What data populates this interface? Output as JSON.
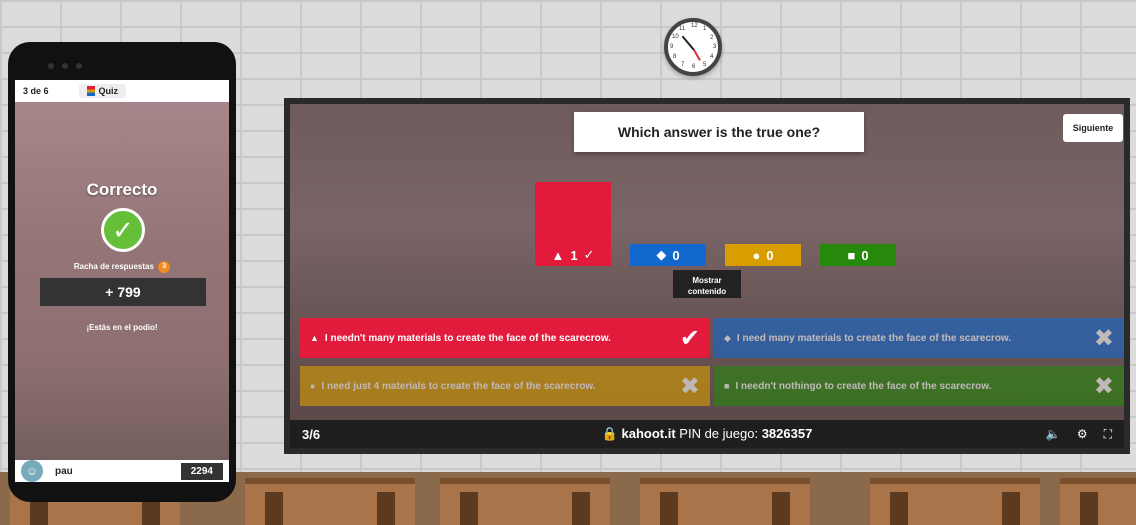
{
  "clock": {
    "numbers": [
      "12",
      "1",
      "2",
      "3",
      "4",
      "5",
      "6",
      "7",
      "8",
      "9",
      "10",
      "11"
    ]
  },
  "phone": {
    "progress": "3 de 6",
    "mode": "Quiz",
    "result": "Correcto",
    "streak_label": "Racha de respuestas",
    "streak_count": "3",
    "points": "+ 799",
    "podium": "¡Estás en el podio!",
    "player": "pau",
    "score": "2294"
  },
  "screen": {
    "question": "Which answer is the true one?",
    "next_label": "Siguiente",
    "show_content": "Mostrar contenido",
    "progress": "3/6",
    "pin_site": "kahoot.it",
    "pin_label": "PIN de juego:",
    "pin": "3826357",
    "bars": [
      {
        "shape": "▲",
        "count": "1",
        "check": "✓",
        "color": "#e21b3c",
        "fraction": 1
      },
      {
        "shape": "◆",
        "count": "0",
        "check": "",
        "color": "#1368ce",
        "fraction": 0
      },
      {
        "shape": "●",
        "count": "0",
        "check": "",
        "color": "#d89e00",
        "fraction": 0
      },
      {
        "shape": "■",
        "count": "0",
        "check": "",
        "color": "#26890c",
        "fraction": 0
      }
    ],
    "answers": [
      {
        "shape": "▲",
        "text": "I needn't many materials to create the face of the scarecrow.",
        "mark": "✔",
        "color": "#e21b3c",
        "correct": true
      },
      {
        "shape": "◆",
        "text": "I need many materials to create the face of the scarecrow.",
        "mark": "✖",
        "color": "#1368ce",
        "correct": false
      },
      {
        "shape": "●",
        "text": "I need just 4 materials to create the face of the scarecrow.",
        "mark": "✖",
        "color": "#d89e00",
        "correct": false
      },
      {
        "shape": "■",
        "text": "I needn't nothingo to create the face of the scarecrow.",
        "mark": "✖",
        "color": "#26890c",
        "correct": false
      }
    ]
  }
}
